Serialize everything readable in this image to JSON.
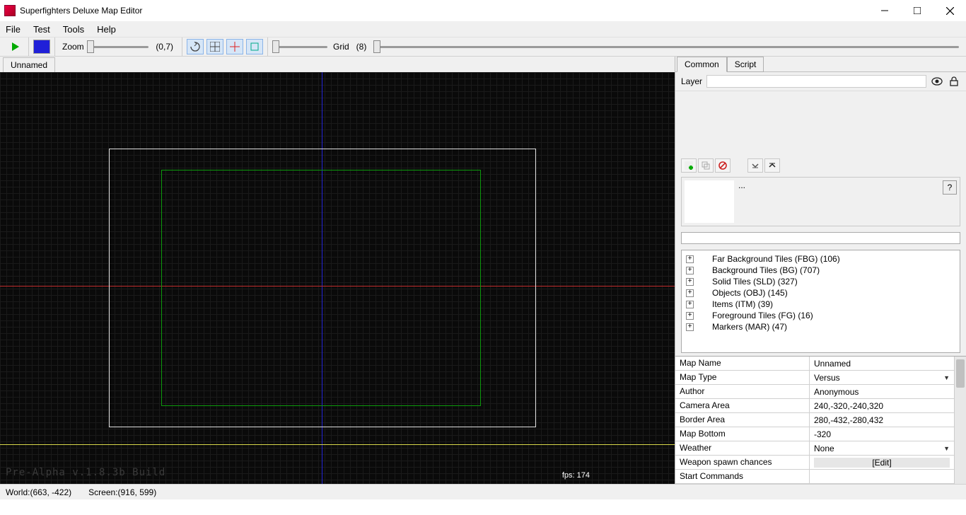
{
  "title": "Superfighters Deluxe Map Editor",
  "menu": {
    "file": "File",
    "test": "Test",
    "tools": "Tools",
    "help": "Help"
  },
  "toolbar": {
    "zoom_label": "Zoom",
    "zoom_coord": "(0,7)",
    "grid_label": "Grid",
    "grid_value": "(8)"
  },
  "doctab": "Unnamed",
  "canvas": {
    "build": "Pre-Alpha v.1.8.3b Build",
    "fps": "fps: 174"
  },
  "right": {
    "tab_common": "Common",
    "tab_script": "Script",
    "layer_label": "Layer",
    "asset_placeholder": "...",
    "tree": [
      "Far Background Tiles (FBG) (106)",
      "Background Tiles (BG) (707)",
      "Solid Tiles (SLD) (327)",
      "Objects (OBJ) (145)",
      "Items (ITM) (39)",
      "Foreground Tiles (FG) (16)",
      "Markers (MAR) (47)"
    ],
    "props": {
      "map_name": {
        "label": "Map Name",
        "value": "Unnamed"
      },
      "map_type": {
        "label": "Map Type",
        "value": "Versus"
      },
      "author": {
        "label": "Author",
        "value": "Anonymous"
      },
      "camera_area": {
        "label": "Camera Area",
        "value": "240,-320,-240,320"
      },
      "border_area": {
        "label": "Border Area",
        "value": "280,-432,-280,432"
      },
      "map_bottom": {
        "label": "Map Bottom",
        "value": "-320"
      },
      "weather": {
        "label": "Weather",
        "value": "None"
      },
      "weapon_spawn": {
        "label": "Weapon spawn chances",
        "value": "[Edit]"
      },
      "start_commands": {
        "label": "Start Commands",
        "value": ""
      }
    }
  },
  "status": {
    "world": "World:(663, -422)",
    "screen": "Screen:(916, 599)"
  }
}
